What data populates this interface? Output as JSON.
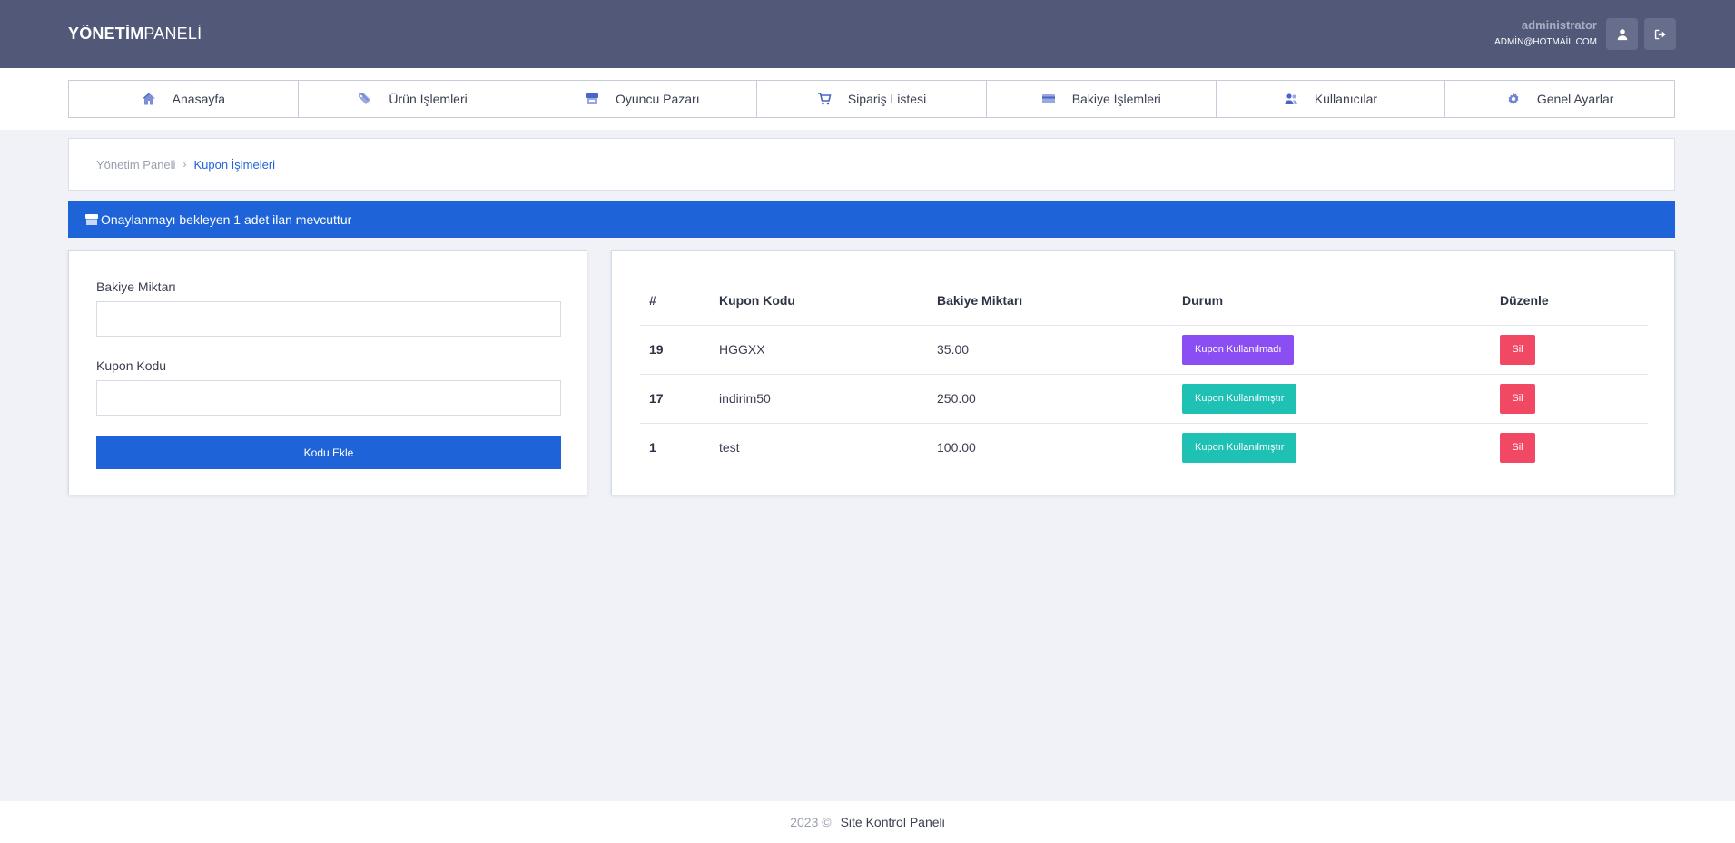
{
  "header": {
    "logo_bold": "YÖNETİM",
    "logo_light": "PANELİ",
    "user_name": "administrator",
    "user_email": "ADMİN@HOTMAİL.COM",
    "profile_icon": "user-icon",
    "logout_icon": "logout-icon"
  },
  "nav": {
    "items": [
      {
        "label": "Anasayfa",
        "icon": "home-icon"
      },
      {
        "label": "Ürün İşlemleri",
        "icon": "tags-icon"
      },
      {
        "label": "Oyuncu Pazarı",
        "icon": "store-icon"
      },
      {
        "label": "Sipariş Listesi",
        "icon": "cart-icon"
      },
      {
        "label": "Bakiye İşlemleri",
        "icon": "credit-card-icon"
      },
      {
        "label": "Kullanıcılar",
        "icon": "users-icon"
      },
      {
        "label": "Genel Ayarlar",
        "icon": "gear-icon"
      }
    ]
  },
  "breadcrumb": {
    "home": "Yönetim Paneli",
    "separator": "›",
    "current": "Kupon İşlmeleri"
  },
  "alert": {
    "text": "Onaylanmayı bekleyen 1 adet ilan mevcuttur",
    "icon": "store-icon"
  },
  "form": {
    "amount_label": "Bakiye Miktarı",
    "amount_value": "",
    "code_label": "Kupon Kodu",
    "code_value": "",
    "submit_label": "Kodu Ekle"
  },
  "table": {
    "columns": [
      "#",
      "Kupon Kodu",
      "Bakiye Miktarı",
      "Durum",
      "Düzenle"
    ],
    "rows": [
      {
        "id": "19",
        "code": "HGGXX",
        "amount": "35.00",
        "status": "Kupon Kullanılmadı",
        "status_type": "unused",
        "action": "Sil"
      },
      {
        "id": "17",
        "code": "indirim50",
        "amount": "250.00",
        "status": "Kupon Kullanılmıştır",
        "status_type": "used",
        "action": "Sil"
      },
      {
        "id": "1",
        "code": "test",
        "amount": "100.00",
        "status": "Kupon Kullanılmıştır",
        "status_type": "used",
        "action": "Sil"
      }
    ]
  },
  "footer": {
    "year": "2023 ©",
    "site": "Site Kontrol Paneli"
  },
  "colors": {
    "header_bg": "#515878",
    "primary": "#1e64d8",
    "badge_unused": "#8a4ef2",
    "badge_used": "#1fc1b5",
    "danger": "#f14863"
  }
}
